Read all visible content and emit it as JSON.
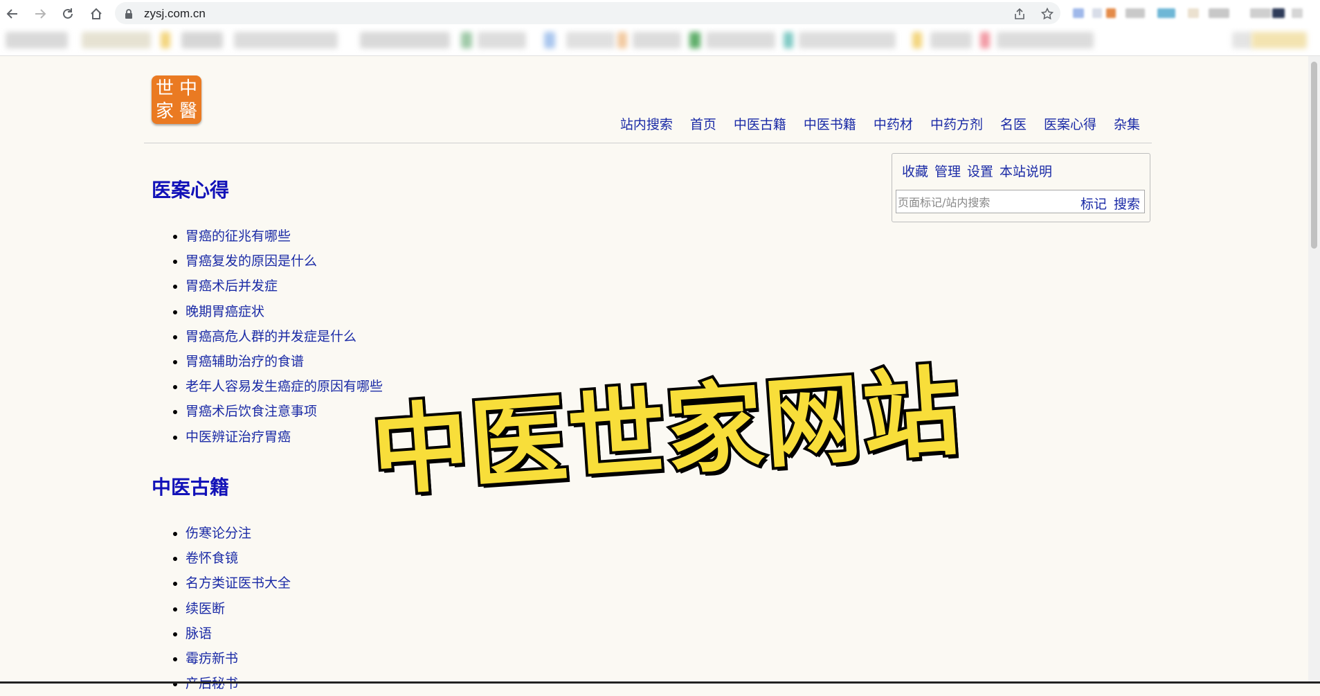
{
  "browser": {
    "url": "zysj.com.cn",
    "icons": [
      "back-icon",
      "forward-icon",
      "reload-icon",
      "home-icon",
      "lock-icon",
      "share-icon",
      "star-icon"
    ]
  },
  "colors": {
    "link": "#1a2aa6",
    "section_title": "#1212b8",
    "logo_bg": "#ea7a22",
    "watermark": "#f8de3a",
    "page_bg": "#fbf9f3"
  },
  "site": {
    "logo_chars": [
      "世",
      "中",
      "家",
      "醫"
    ],
    "nav": [
      "站内搜索",
      "首页",
      "中医古籍",
      "中医书籍",
      "中药材",
      "中药方剂",
      "名医",
      "医案心得",
      "杂集"
    ],
    "toolbox": {
      "links": [
        "收藏",
        "管理",
        "设置",
        "本站说明"
      ],
      "input_placeholder": "页面标记/站内搜索",
      "mark_label": "标记",
      "search_label": "搜索"
    }
  },
  "sections": [
    {
      "title": "医案心得",
      "items": [
        "胃癌的征兆有哪些",
        "胃癌复发的原因是什么",
        "胃癌术后并发症",
        "晚期胃癌症状",
        "胃癌高危人群的并发症是什么",
        "胃癌辅助治疗的食谱",
        "老年人容易发生癌症的原因有哪些",
        "胃癌术后饮食注意事项",
        "中医辨证治疗胃癌"
      ]
    },
    {
      "title": "中医古籍",
      "items": [
        "伤寒论分注",
        "卷怀食镜",
        "名方类证医书大全",
        "续医断",
        "脉语",
        "霉疠新书",
        "产后秘书"
      ]
    }
  ],
  "overlay_text": "中医世家网站"
}
